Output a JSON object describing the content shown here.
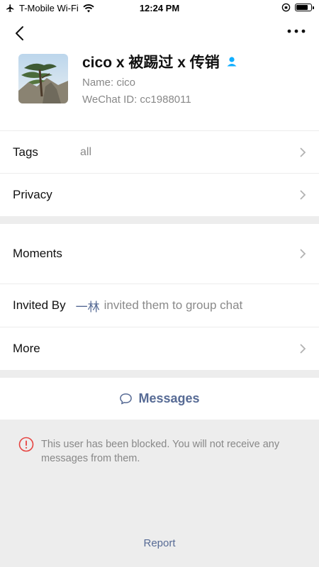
{
  "status_bar": {
    "carrier": "T-Mobile Wi-Fi",
    "time": "12:24 PM"
  },
  "profile": {
    "display_name": "cico x 被踢过 x 传销",
    "name_line": "Name: cico",
    "wechat_id_line": "WeChat ID: cc1988011"
  },
  "rows": {
    "tags_label": "Tags",
    "tags_value": "all",
    "privacy_label": "Privacy",
    "moments_label": "Moments",
    "invited_by_label": "Invited By",
    "invited_by_name": "一林",
    "invited_by_text": "invited them to group chat",
    "more_label": "More"
  },
  "actions": {
    "messages_label": "Messages",
    "blocked_message": "This user has been blocked. You will not receive any messages from them.",
    "report_label": "Report"
  },
  "colors": {
    "link": "#576b95",
    "warning": "#e64340",
    "contact_badge": "#10aeff"
  }
}
